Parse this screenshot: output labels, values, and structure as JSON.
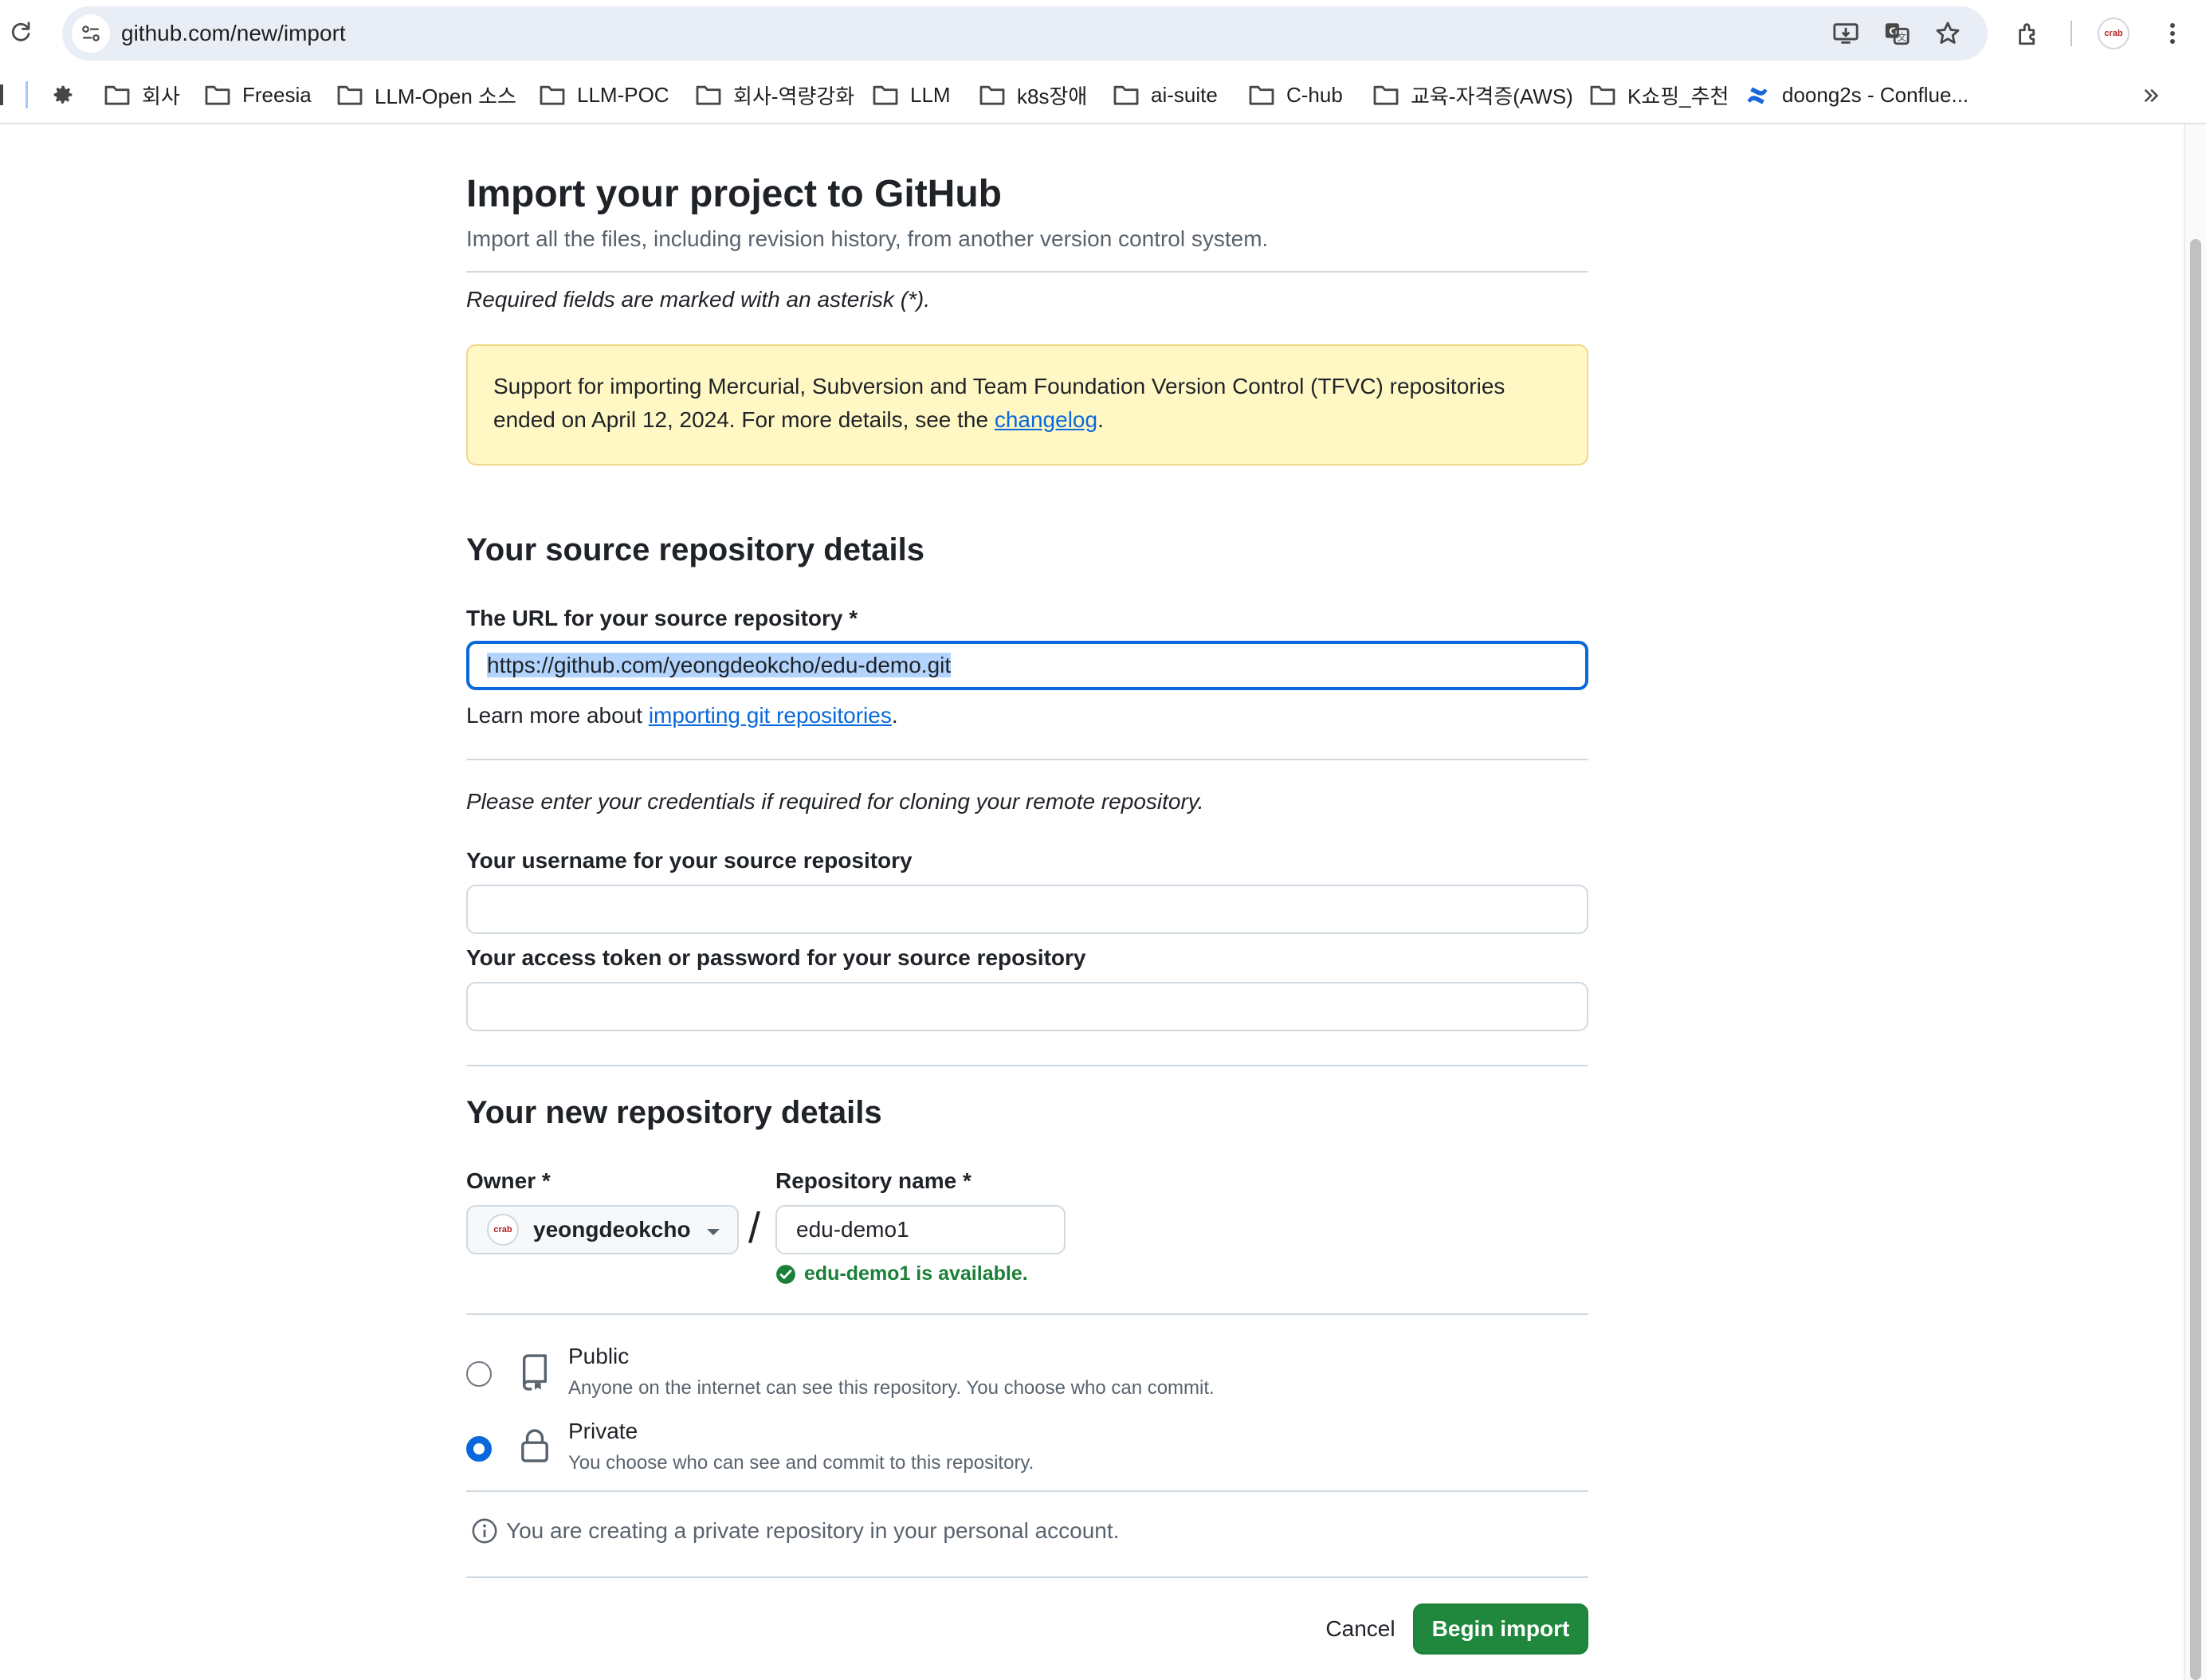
{
  "browser": {
    "url": "github.com/new/import",
    "profile_badge": "crab"
  },
  "bookmarks": [
    {
      "label": "회사"
    },
    {
      "label": "Freesia"
    },
    {
      "label": "LLM-Open 소스"
    },
    {
      "label": "LLM-POC"
    },
    {
      "label": "회사-역량강화"
    },
    {
      "label": "LLM"
    },
    {
      "label": "k8s장애"
    },
    {
      "label": "ai-suite"
    },
    {
      "label": "C-hub"
    },
    {
      "label": "교육-자격증(AWS)"
    },
    {
      "label": "K쇼핑_추천"
    },
    {
      "label": "doong2s - Conflue..."
    }
  ],
  "page": {
    "title": "Import your project to GitHub",
    "subtitle": "Import all the files, including revision history, from another version control system.",
    "required_note": "Required fields are marked with an asterisk (*).",
    "flash": {
      "text_before": "Support for importing Mercurial, Subversion and Team Foundation Version Control (TFVC) repositories ended on April 12, 2024. For more details, see the ",
      "link": "changelog",
      "text_after": "."
    },
    "source": {
      "heading": "Your source repository details",
      "url_label": "The URL for your source repository *",
      "url_value": "https://github.com/yeongdeokcho/edu-demo.git",
      "learn_prefix": "Learn more about ",
      "learn_link": "importing git repositories",
      "learn_suffix": ".",
      "credentials_note": "Please enter your credentials if required for cloning your remote repository.",
      "username_label": "Your username for your source repository",
      "username_value": "",
      "token_label": "Your access token or password for your source repository",
      "token_value": ""
    },
    "new_repo": {
      "heading": "Your new repository details",
      "owner_label": "Owner *",
      "owner_value": "yeongdeokcho",
      "slash": "/",
      "name_label": "Repository name *",
      "name_value": "edu-demo1",
      "availability": "edu-demo1 is available.",
      "visibility": [
        {
          "title": "Public",
          "description": "Anyone on the internet can see this repository. You choose who can commit.",
          "checked": false
        },
        {
          "title": "Private",
          "description": "You choose who can see and commit to this repository.",
          "checked": true
        }
      ],
      "info": "You are creating a private repository in your personal account."
    },
    "actions": {
      "cancel": "Cancel",
      "submit": "Begin import"
    }
  },
  "colors": {
    "primary_button": "#1f883d",
    "link": "#0969da",
    "success": "#1a7f37",
    "flash_bg": "#fff8c5"
  }
}
